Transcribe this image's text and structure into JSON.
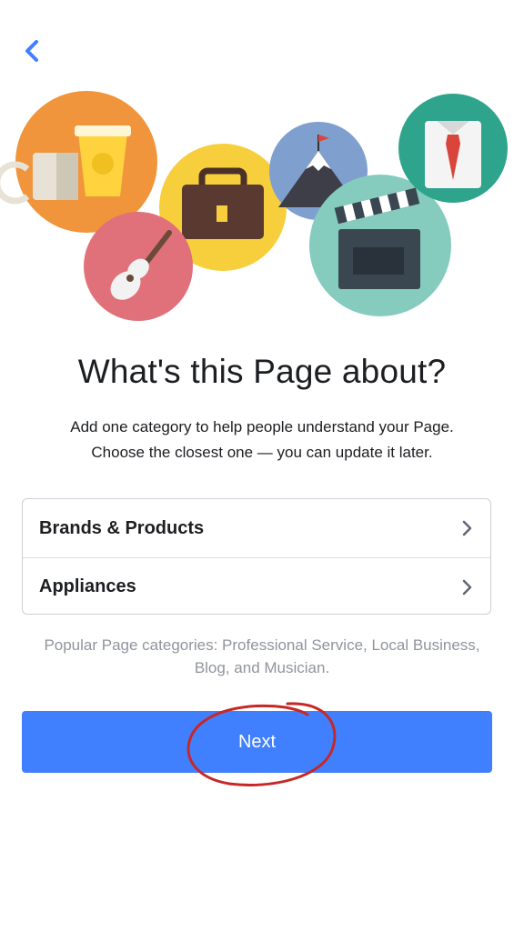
{
  "header": {
    "back_icon": "chevron-left-icon"
  },
  "hero": {
    "icons": [
      "coffee-cups-icon",
      "briefcase-icon",
      "guitar-icon",
      "mountain-flag-icon",
      "clapperboard-icon",
      "shirt-tie-icon"
    ]
  },
  "title": "What's this Page about?",
  "subtitle": {
    "line1": "Add one category to help people understand your Page.",
    "line2": "Choose the closest one — you can update it later."
  },
  "categories": [
    {
      "label": "Brands & Products"
    },
    {
      "label": "Appliances"
    }
  ],
  "hint": {
    "line1": "Popular Page categories: Professional Service, Local Business,",
    "line2": "Blog, and Musician."
  },
  "next_button": {
    "label": "Next"
  },
  "colors": {
    "accent": "#4080ff",
    "annotation": "#c62828",
    "text": "#1c1e21",
    "muted": "#90949c"
  }
}
